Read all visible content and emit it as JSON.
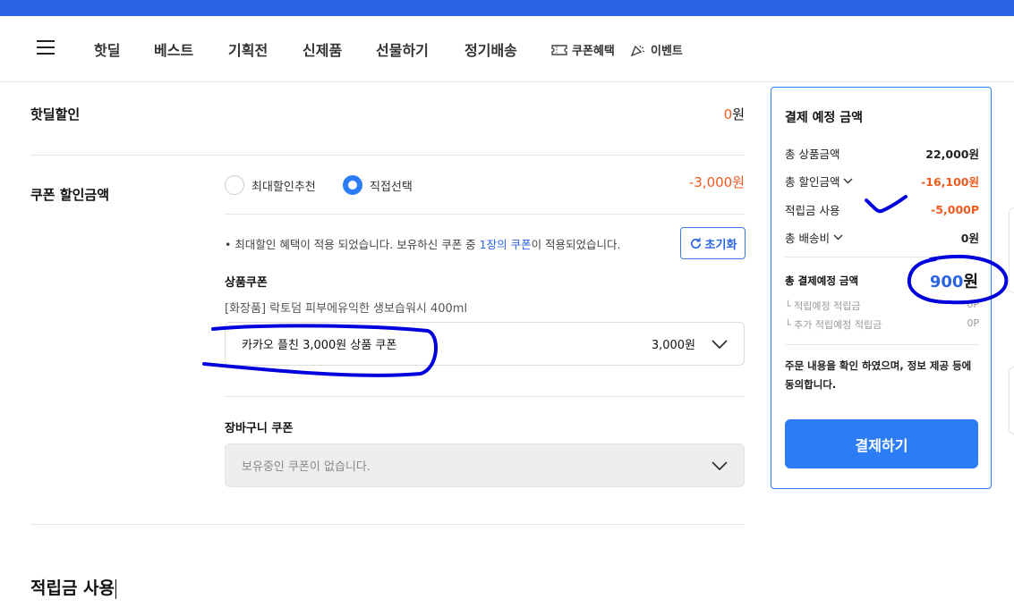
{
  "nav": {
    "items": [
      "핫딜",
      "베스트",
      "기획전",
      "신제품",
      "선물하기",
      "정기배송"
    ],
    "coupon_benefit": "쿠폰혜택",
    "event": "이벤트"
  },
  "hotdeal": {
    "label": "핫딜할인",
    "amount_num": "0",
    "amount_unit": "원"
  },
  "coupon": {
    "label": "쿠폰 할인금액",
    "amount": "-3,000원",
    "radio_max": "최대할인추천",
    "radio_direct": "직접선택",
    "notice_pre": "• 최대할인 혜택이 적용 되었습니다. 보유하신 쿠폰 중 ",
    "notice_link": "1장의 쿠폰",
    "notice_post": "이 적용되었습니다.",
    "reset_label": "초기화",
    "product_coupon_title": "상품쿠폰",
    "product_name": "[화장품] 락토덤 피부에유익한 생보습워시 400ml",
    "product_coupon_value": "카카오 플친 3,000원 상품 쿠폰",
    "product_coupon_amount": "3,000원",
    "cart_coupon_title": "장바구니 쿠폰",
    "cart_coupon_placeholder": "보유중인 쿠폰이 없습니다."
  },
  "points_section_title": "적립금 사용",
  "summary": {
    "title": "결제 예정 금액",
    "rows": [
      {
        "label": "총 상품금액",
        "value": "22,000원"
      },
      {
        "label": "총 할인금액",
        "value": "-16,100원"
      },
      {
        "label": "적립금 사용",
        "value": "-5,000P"
      },
      {
        "label": "총 배송비",
        "value": "0원"
      }
    ],
    "total_label": "총 결제예정 금액",
    "total_num": "900",
    "total_unit": "원",
    "expected_points_label": "└ 적립예정 적립금",
    "expected_points_value": "0P",
    "extra_points_label": "└ 추가 적립예정 적립금",
    "extra_points_value": "0P",
    "agree_text": "주문 내용을 확인 하였으며, 정보 제공 등에 동의합니다.",
    "pay_button": "결제하기"
  },
  "colors": {
    "accent_blue": "#2b7cf5",
    "discount_orange": "#f05a1e",
    "annotation_pen": "#0000dd"
  }
}
